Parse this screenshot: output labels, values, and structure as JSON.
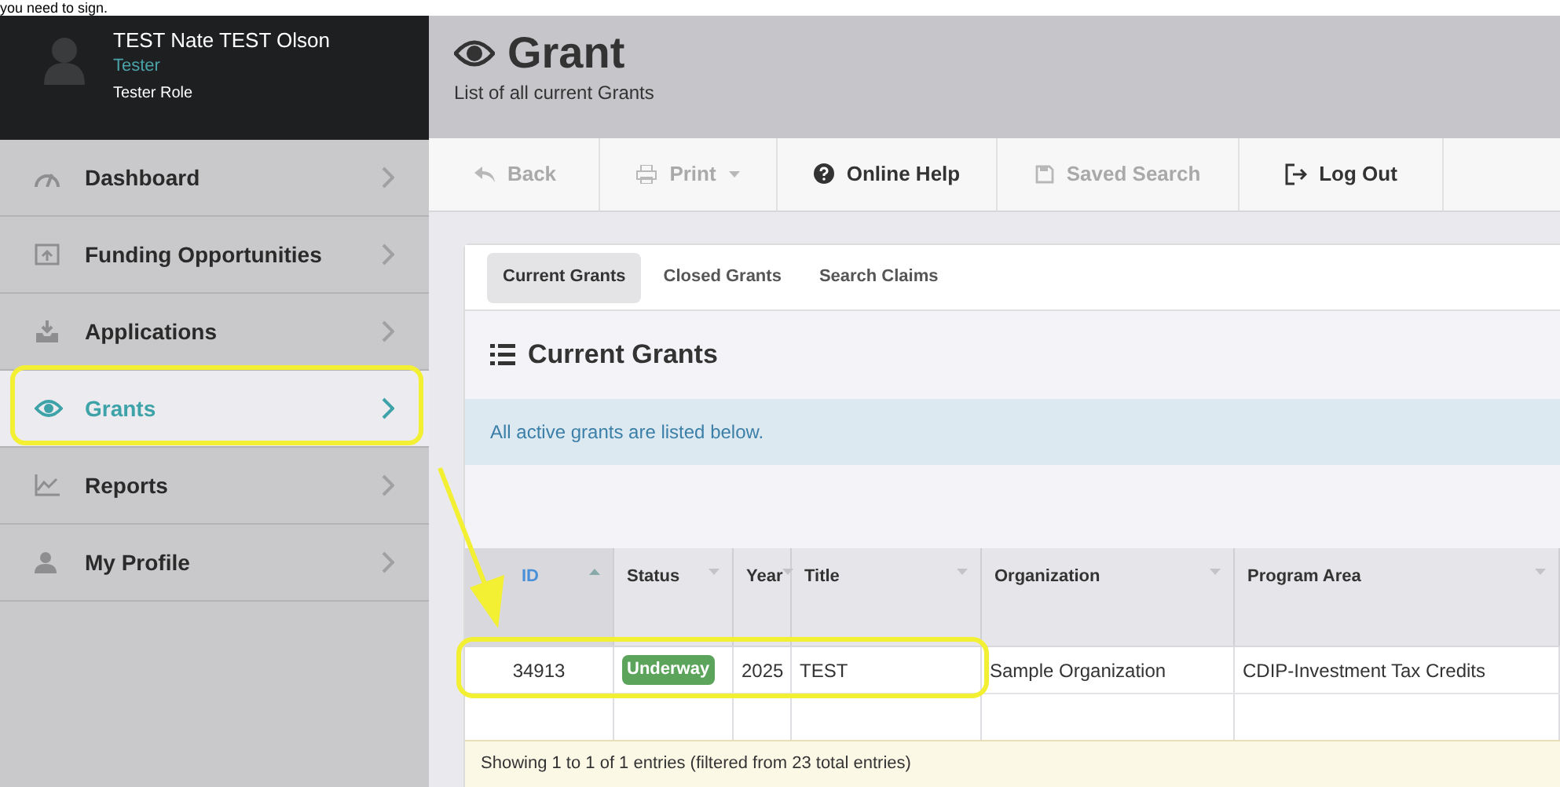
{
  "caption": "you need to sign.",
  "user": {
    "name": "TEST Nate TEST Olson",
    "title": "Tester",
    "role": "Tester Role"
  },
  "sidebar": {
    "items": [
      {
        "label": "Dashboard",
        "selected": false
      },
      {
        "label": "Funding Opportunities",
        "selected": false
      },
      {
        "label": "Applications",
        "selected": false
      },
      {
        "label": "Grants",
        "selected": true
      },
      {
        "label": "Reports",
        "selected": false
      },
      {
        "label": "My Profile",
        "selected": false
      }
    ]
  },
  "page": {
    "title": "Grant",
    "subtitle": "List of all current Grants"
  },
  "toolbar": [
    {
      "label": "Back",
      "disabled": true
    },
    {
      "label": "Print",
      "disabled": true,
      "dropdown": true
    },
    {
      "label": "Online Help",
      "disabled": false
    },
    {
      "label": "Saved Search",
      "disabled": true
    },
    {
      "label": "Log Out",
      "disabled": false
    }
  ],
  "tabs": [
    {
      "label": "Current Grants",
      "selected": true
    },
    {
      "label": "Closed Grants",
      "selected": false
    },
    {
      "label": "Search Claims",
      "selected": false
    }
  ],
  "panel": {
    "title": "Current Grants",
    "info": "All active grants are listed below."
  },
  "table": {
    "columns": [
      {
        "label": "ID",
        "sorted": true
      },
      {
        "label": "Status",
        "sorted": false
      },
      {
        "label": "Year",
        "sorted": false
      },
      {
        "label": "Title",
        "sorted": false
      },
      {
        "label": "Organization",
        "sorted": false
      },
      {
        "label": "Program Area",
        "sorted": false
      }
    ],
    "rows": [
      {
        "cells": [
          "34913",
          "Underway",
          "2025",
          "TEST",
          "Sample Organization",
          "CDIP-Investment Tax Credits"
        ]
      }
    ],
    "footer": "Showing 1 to 1 of 1 entries (filtered from 23 total entries)"
  }
}
